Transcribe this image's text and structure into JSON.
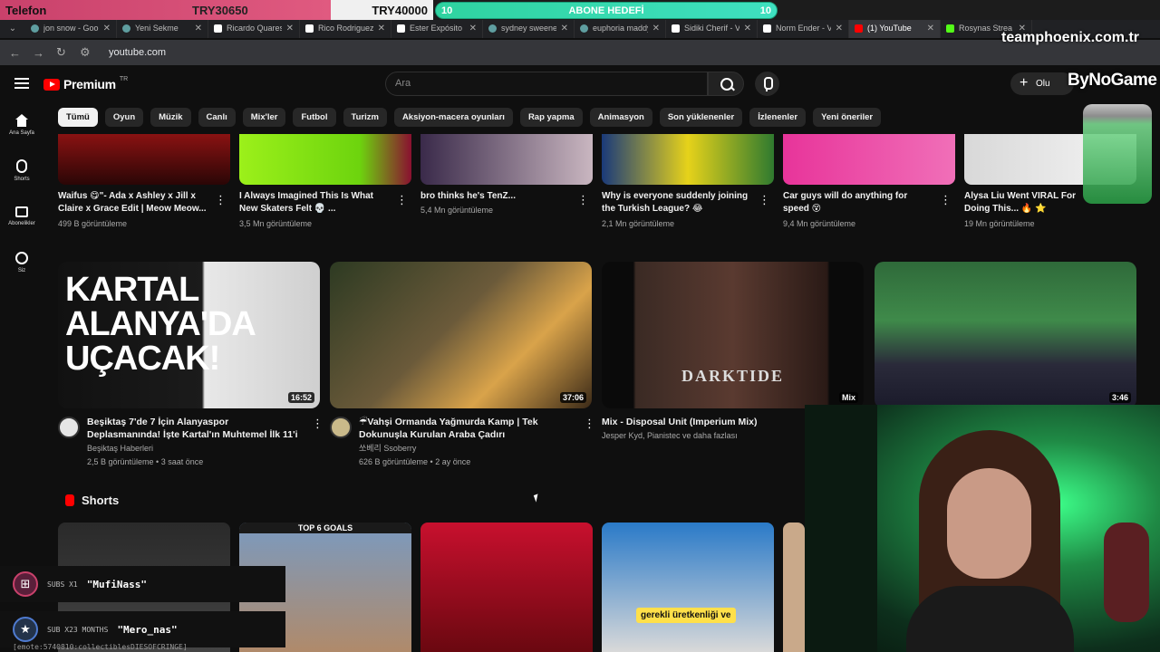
{
  "stream": {
    "phone_label": "Telefon",
    "phone_value": "TRY30650",
    "second_value": "TRY40000",
    "goal_left": "10",
    "goal_title": "ABONE HEDEFİ",
    "goal_right": "10",
    "brand": "teamphoenix.com.tr",
    "sponsor": "ByNoGame",
    "alerts": [
      {
        "kind": "SUBS X1",
        "user": "\"MufiNass\""
      },
      {
        "kind": "SUB X23 MONTHS",
        "user": "\"Mero_nas\""
      }
    ],
    "debug_text": "[emote:5740810:collectiblesDIESOFCRINGE]"
  },
  "browser": {
    "tabs": [
      {
        "title": "jon snow - Goo",
        "icon": "google-icon"
      },
      {
        "title": "Yeni Sekme",
        "icon": "newtab-icon"
      },
      {
        "title": "Ricardo Quares",
        "icon": "wikipedia-icon"
      },
      {
        "title": "Rico Rodriguez",
        "icon": "wikipedia-icon"
      },
      {
        "title": "Ester Expósito",
        "icon": "wikipedia-icon"
      },
      {
        "title": "sydney sweene",
        "icon": "google-icon"
      },
      {
        "title": "euphoria maddy",
        "icon": "google-icon"
      },
      {
        "title": "Sidiki Cherif - V",
        "icon": "wikipedia-icon"
      },
      {
        "title": "Norm Ender - V",
        "icon": "wikipedia-icon"
      },
      {
        "title": "(1) YouTube",
        "icon": "youtube-icon"
      },
      {
        "title": "Rosynas Strea",
        "icon": "kick-icon"
      }
    ],
    "url": "youtube.com"
  },
  "youtube": {
    "logo": "Premium",
    "logo_sup": "TR",
    "search_placeholder": "Ara",
    "create_label": "Olu",
    "sidebar": [
      {
        "label": "Ana Sayfa",
        "icon": "home-icon"
      },
      {
        "label": "Shorts",
        "icon": "shorts-icon"
      },
      {
        "label": "Abonelikler",
        "icon": "subscriptions-icon"
      },
      {
        "label": "Siz",
        "icon": "you-icon"
      }
    ],
    "chips": [
      "Tümü",
      "Oyun",
      "Müzik",
      "Canlı",
      "Mix'ler",
      "Futbol",
      "Turizm",
      "Aksiyon-macera oyunları",
      "Rap yapma",
      "Animasyon",
      "Son yüklenenler",
      "İzlenenler",
      "Yeni öneriler"
    ],
    "row1": [
      {
        "title": "Waifus 😋\"- Ada x Ashley x Jill x Claire x Grace Edit | Meow Meow...",
        "views": "499 B görüntüleme"
      },
      {
        "title": "I Always Imagined This Is What New Skaters Felt 💀 ...",
        "views": "3,5 Mn görüntüleme"
      },
      {
        "title": "bro thinks he's TenZ...",
        "views": "5,4 Mn görüntüleme"
      },
      {
        "title": "Why is everyone suddenly joining the Turkish League? 😂",
        "views": "2,1 Mn görüntüleme"
      },
      {
        "title": "Car guys will do anything for speed 😵",
        "views": "9,4 Mn görüntüleme"
      },
      {
        "title": "Alysa Liu Went VIRAL For Doing This... 🔥 ⭐",
        "views": "19 Mn görüntüleme"
      }
    ],
    "row2": [
      {
        "title": "Beşiktaş 7'de 7 İçin Alanyaspor Deplasmanında! İşte Kartal'ın Muhtemel İlk 11'i",
        "channel": "Beşiktaş Haberleri",
        "meta": "2,5 B görüntüleme • 3 saat önce",
        "duration": "16:52",
        "thumb_text": "KARTAL ALANYA'DA UÇACAK!"
      },
      {
        "title": "☔Vahşi Ormanda Yağmurda Kamp | Tek Dokunuşla Kurulan Araba Çadırı",
        "channel": "쏘베리 Ssoberry",
        "meta": "626 B görüntüleme • 2 ay önce",
        "duration": "37:06"
      },
      {
        "title": "Mix - Disposal Unit (Imperium Mix)",
        "channel": "Jesper Kyd, Pianistec ve daha fazlası",
        "meta": "",
        "duration": "Mix",
        "thumb_text": "DARKTIDE"
      },
      {
        "title": "",
        "channel": "",
        "meta": "",
        "duration": "3:46"
      }
    ],
    "shorts_title": "Shorts",
    "short_caption": "gerekli üretkenliği ve",
    "short_top_text": "TOP 6 GOALS"
  }
}
